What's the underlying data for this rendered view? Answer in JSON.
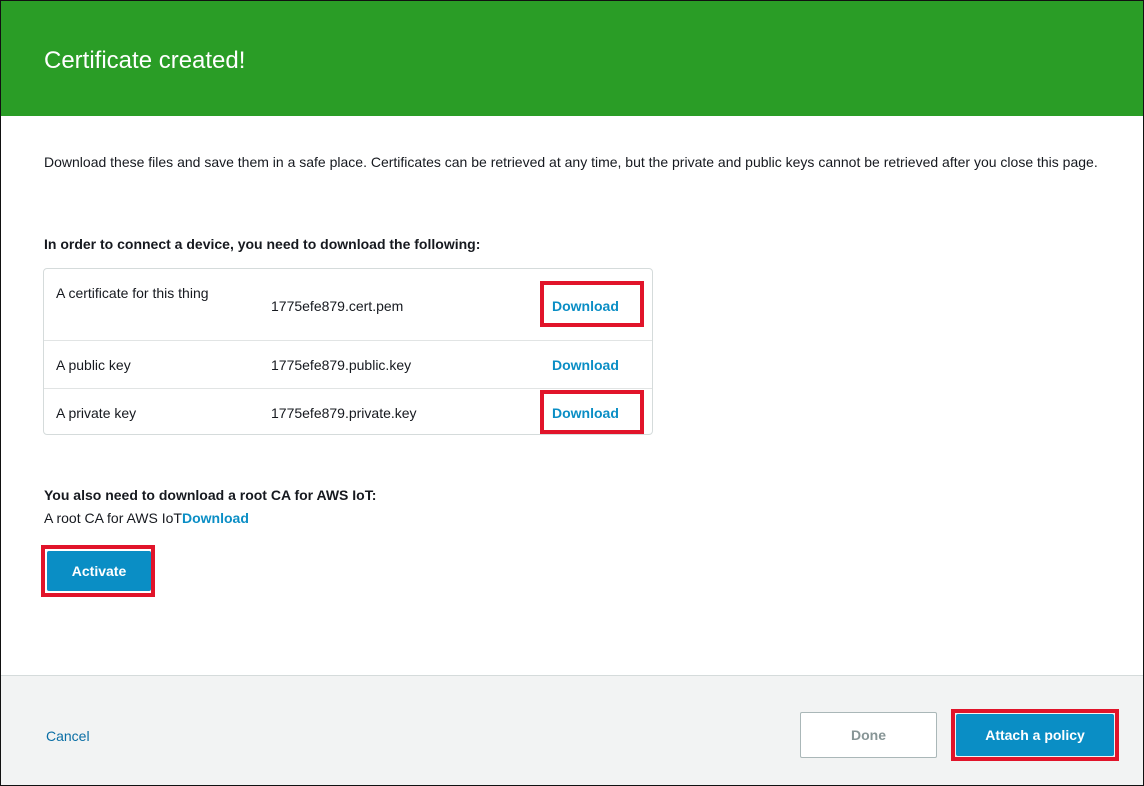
{
  "header": {
    "title": "Certificate created!"
  },
  "intro": {
    "text": "Download these files and save them in a safe place. Certificates can be retrieved at any time, but the private and public keys cannot be retrieved after you close this page."
  },
  "files_section": {
    "heading": "In order to connect a device, you need to download the following:",
    "rows": [
      {
        "description": "A certificate for this thing",
        "filename": "1775efe879.cert.pem",
        "action": "Download",
        "highlighted": true
      },
      {
        "description": "A public key",
        "filename": "1775efe879.public.key",
        "action": "Download",
        "highlighted": false
      },
      {
        "description": "A private key",
        "filename": "1775efe879.private.key",
        "action": "Download",
        "highlighted": true
      }
    ]
  },
  "root_ca": {
    "heading": "You also need to download a root CA for AWS IoT:",
    "label": "A root CA for AWS IoT",
    "action": "Download"
  },
  "activate_button": "Activate",
  "footer": {
    "cancel": "Cancel",
    "done": "Done",
    "attach_policy": "Attach a policy"
  },
  "colors": {
    "header_green": "#2a9d26",
    "link_blue": "#0a8ec5",
    "primary_button": "#0a8ec5",
    "highlight_red": "#e1142a",
    "footer_bg": "#f2f3f3"
  }
}
